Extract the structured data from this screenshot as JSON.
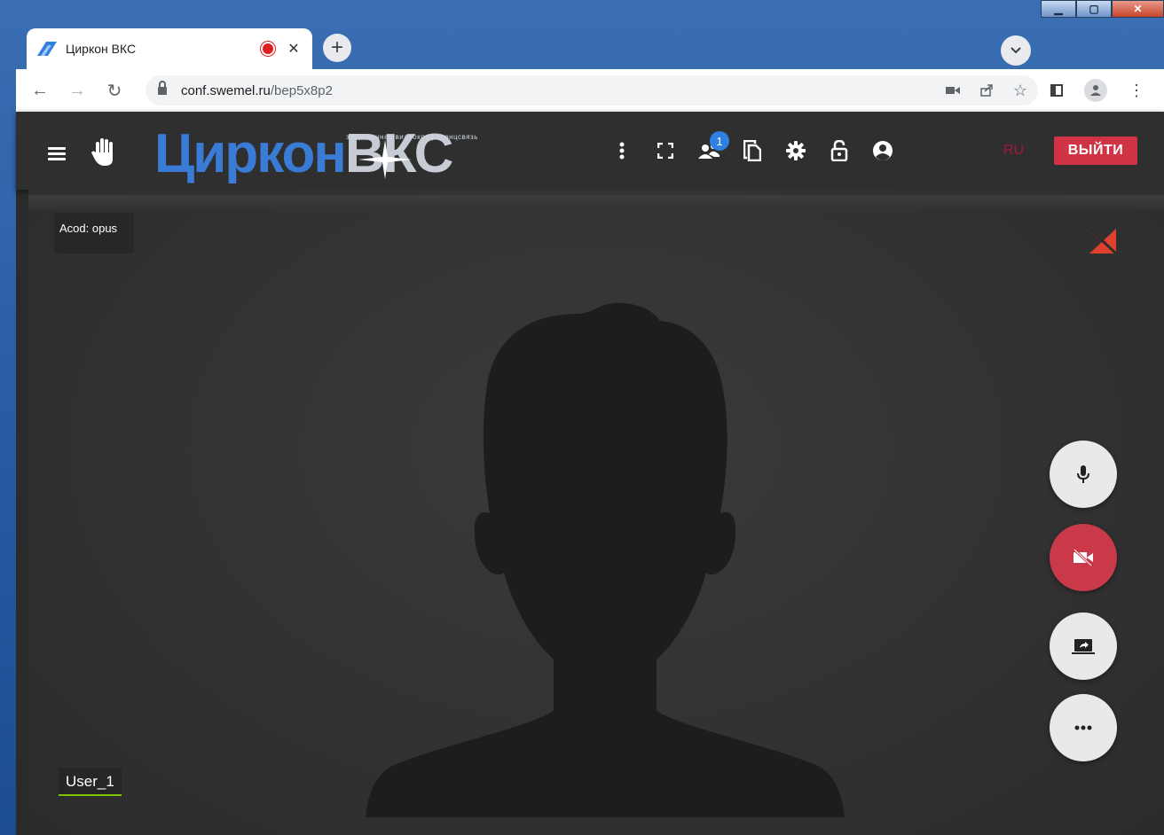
{
  "browser": {
    "tab": {
      "title": "Циркон ВКС"
    },
    "address": {
      "host": "conf.swemel.ru",
      "path": "/bep5x8p2"
    }
  },
  "app": {
    "logo": {
      "subtitle": "защищенная видеоконференцсвязь",
      "main": "Циркон",
      "suffix": "ВКС"
    },
    "participants_count": "1",
    "language": "RU",
    "logout_label": "ВЫЙТИ"
  },
  "video": {
    "codec_label": "Acod: opus",
    "username": "User_1"
  },
  "colors": {
    "accent": "#3a7bd5",
    "danger": "#d03344",
    "active_speaker": "#7ec400"
  }
}
